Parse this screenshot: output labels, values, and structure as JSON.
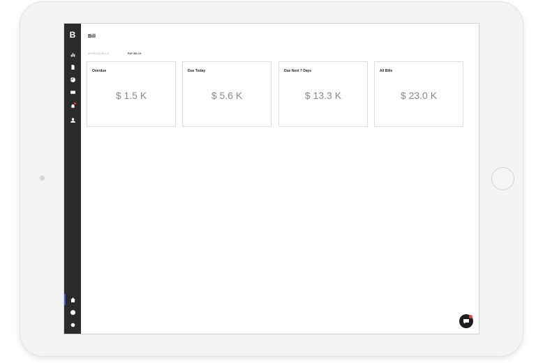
{
  "sidebar": {
    "logo": "B",
    "icons": [
      "bar-chart-icon",
      "document-icon",
      "pie-chart-icon",
      "credit-card-icon",
      "bell-icon",
      "user-icon"
    ],
    "bottom_icons": [
      "home-icon",
      "help-icon",
      "settings-icon"
    ]
  },
  "page": {
    "title": "Bill"
  },
  "tabs": [
    {
      "label": "Approve Bills",
      "active": false
    },
    {
      "label": "Pay Bills",
      "active": true
    }
  ],
  "cards": [
    {
      "title": "Overdue",
      "value": "$ 1.5 K"
    },
    {
      "title": "Due Today",
      "value": "$ 5.6 K"
    },
    {
      "title": "Due Next 7 Days",
      "value": "$ 13.3 K"
    },
    {
      "title": "All Bills",
      "value": "$ 23.0 K"
    }
  ],
  "chat": {
    "icon": "chat-icon",
    "badge_color": "#ef4444"
  },
  "colors": {
    "sidebar": "#2b2b2b",
    "accent": "#3b5bdb",
    "value_text": "#8a8a8a"
  }
}
